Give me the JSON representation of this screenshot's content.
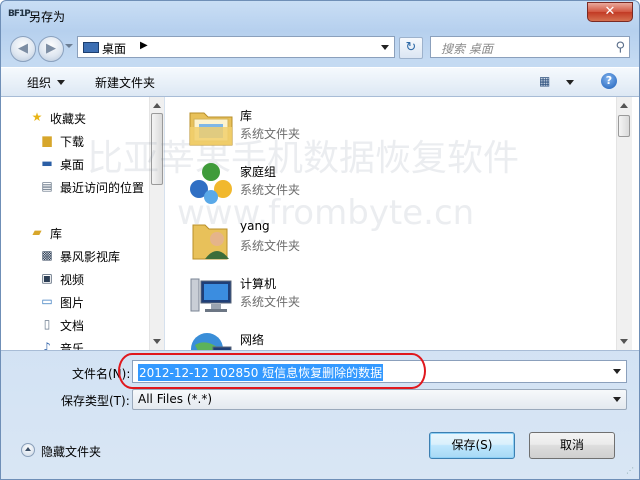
{
  "window": {
    "title": "另存为",
    "app_icon": "BF1P",
    "close_glyph": "✕"
  },
  "nav": {
    "back_glyph": "◀",
    "forward_glyph": "▶",
    "address": {
      "location": "桌面",
      "separator": "▶"
    },
    "refresh_glyph": "↻",
    "search_placeholder": "搜索 桌面",
    "search_glyph": "⚲"
  },
  "toolbar": {
    "organize": "组织",
    "new_folder": "新建文件夹",
    "help_glyph": "?"
  },
  "sidebar": {
    "favorites": {
      "label": "收藏夹",
      "items": [
        {
          "label": "下载",
          "icon": "download-folder-icon"
        },
        {
          "label": "桌面",
          "icon": "desktop-icon"
        },
        {
          "label": "最近访问的位置",
          "icon": "recent-places-icon"
        }
      ]
    },
    "libraries": {
      "label": "库",
      "items": [
        {
          "label": "暴风影视库",
          "icon": "video-library-icon"
        },
        {
          "label": "视频",
          "icon": "videos-icon"
        },
        {
          "label": "图片",
          "icon": "pictures-icon"
        },
        {
          "label": "文档",
          "icon": "documents-icon"
        },
        {
          "label": "音乐",
          "icon": "music-icon"
        }
      ]
    }
  },
  "files": [
    {
      "name": "库",
      "type": "系统文件夹",
      "icon": "libraries-folder-icon"
    },
    {
      "name": "家庭组",
      "type": "系统文件夹",
      "icon": "homegroup-icon"
    },
    {
      "name": "yang",
      "type": "系统文件夹",
      "icon": "user-folder-icon"
    },
    {
      "name": "计算机",
      "type": "系统文件夹",
      "icon": "computer-icon"
    },
    {
      "name": "网络",
      "type": "",
      "icon": "network-icon"
    }
  ],
  "watermark": {
    "line1": "比亚莘果手机数据恢复软件",
    "line2": "www.frombyte.cn"
  },
  "form": {
    "filename_label": "文件名(N):",
    "filename_value": "2012-12-12 102850 短信息恢复删除的数据",
    "filetype_label": "保存类型(T):",
    "filetype_value": "All Files (*.*)"
  },
  "footer": {
    "hide_folders": "隐藏文件夹",
    "save_button": "保存(S)",
    "cancel_button": "取消"
  },
  "colors": {
    "selection": "#3399ff",
    "annotation": "#e0181e",
    "close_red": "#c23a24"
  }
}
